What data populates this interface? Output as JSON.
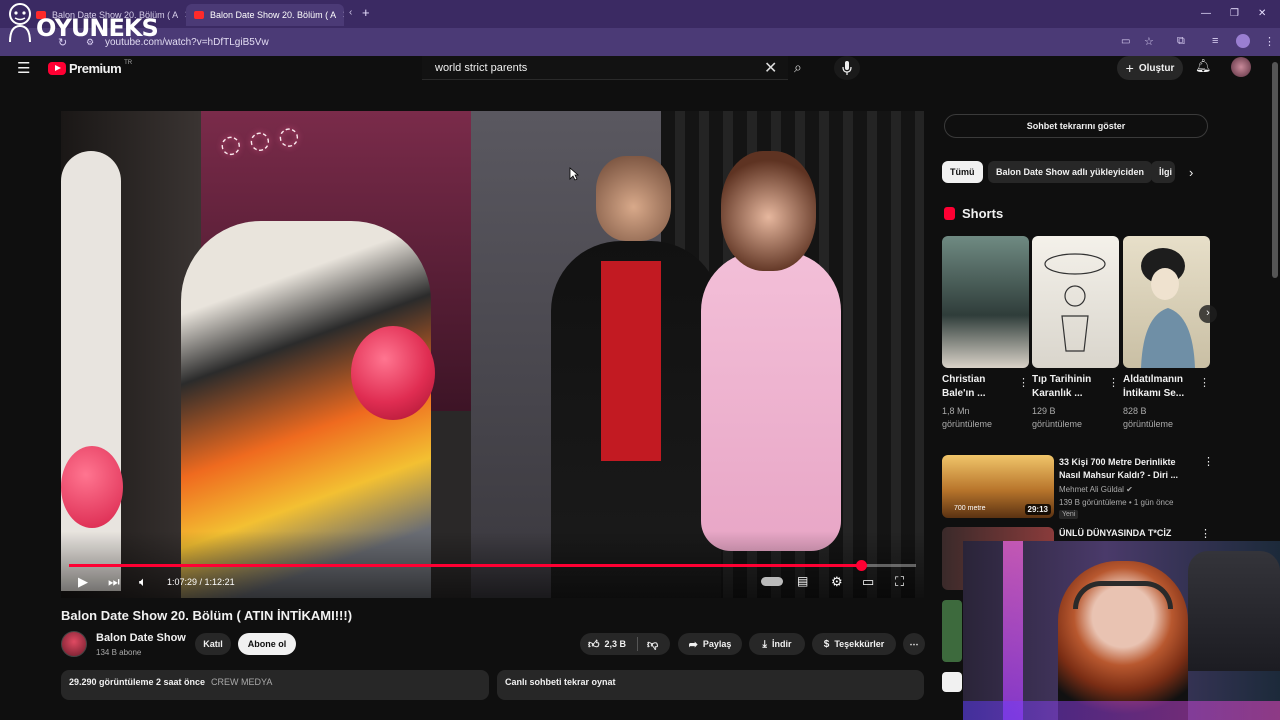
{
  "browser": {
    "tabs": [
      {
        "title": "Balon Date Show 20. Bölüm ( A"
      },
      {
        "title": "Balon Date Show 20. Bölüm ( A"
      }
    ],
    "url": "youtube.com/watch?v=hDfTLgiB5Vw"
  },
  "overlay_logo": {
    "text": "OYUNEKS"
  },
  "youtube": {
    "logo_text": "Premium",
    "logo_sup": "TR",
    "search_value": "world strict parents",
    "create_label": "Oluştur"
  },
  "player": {
    "time_current": "1:07:29",
    "time_total": "1:12:21",
    "progress_fraction": 0.935
  },
  "video": {
    "title": "Balon Date Show 20. Bölüm ( ATIN İNTİKAMI!!!)",
    "channel": "Balon Date Show",
    "subscribers": "134 B abone",
    "join_label": "Katıl",
    "subscribe_label": "Abone ol",
    "likes": "2,3 B",
    "share_label": "Paylaş",
    "download_label": "İndir",
    "thanks_label": "Teşekkürler",
    "views_date": "29.290 görüntüleme  2 saat önce",
    "crew": "CREW MEDYA",
    "live_replay": "Canlı sohbeti tekrar oynat"
  },
  "sidebar": {
    "chat_replay": "Sohbet tekrarını göster",
    "chips": [
      "Tümü",
      "Balon Date Show adlı yükleyiciden",
      "İlgi"
    ],
    "shorts_title": "Shorts",
    "shorts": [
      {
        "title": "Christian Bale'ın ...",
        "views": "1,8 Mn görüntüleme"
      },
      {
        "title": "Tıp Tarihinin Karanlık ...",
        "views": "129 B görüntüleme"
      },
      {
        "title": "Aldatılmanın İntikamı Se...",
        "views": "828 B görüntüleme"
      }
    ],
    "rec1": {
      "title": "33 Kişi 700 Metre Derinlikte Nasıl Mahsur Kaldı? - Diri ...",
      "channel": "Mehmet Ali Güldal",
      "meta": "139 B görüntüleme • 1 gün önce",
      "badge": "Yeni",
      "duration": "29:13"
    },
    "rec2": {
      "title": "ÜNLÜ DÜNYASINDA T*CİZ"
    }
  },
  "colors": {
    "accent": "#ff0033",
    "browser_frame": "#4b3a76"
  }
}
